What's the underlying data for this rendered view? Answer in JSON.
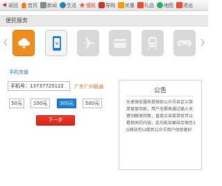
{
  "nav": {
    "items": [
      {
        "label": "返回",
        "icon": "back-arrow-icon"
      },
      {
        "label": "首页",
        "icon": "home-icon"
      },
      {
        "label": "新闻",
        "icon": "news-icon"
      },
      {
        "label": "生活",
        "icon": "life-icon"
      },
      {
        "label": "便民",
        "icon": "service-star-icon",
        "active": true
      },
      {
        "label": "导购",
        "icon": "guide-icon"
      },
      {
        "label": "优惠",
        "icon": "deal-icon"
      },
      {
        "label": "礼品",
        "icon": "gift-icon"
      },
      {
        "label": "地图",
        "icon": "map-icon"
      },
      {
        "label": "退出",
        "icon": "exit-icon"
      }
    ]
  },
  "section": {
    "title": "便民服务"
  },
  "services": [
    {
      "icon": "weather-cloud-icon",
      "state": "orange"
    },
    {
      "icon": "mobile-recharge-icon",
      "state": "selected"
    },
    {
      "icon": "airplane-icon",
      "state": "disabled"
    },
    {
      "icon": "card-icon",
      "state": "disabled"
    },
    {
      "icon": "train-icon",
      "state": "disabled"
    },
    {
      "icon": "gamepad-icon",
      "state": "disabled"
    }
  ],
  "form": {
    "title": "手机充值",
    "phone_value": "手机号：13737725122",
    "carrier": "广东广州联通",
    "amounts": [
      "50元",
      "100元",
      "300元",
      "500元"
    ],
    "selected_amount": "300元",
    "next_label": "下一步"
  },
  "notice": {
    "title": "公告",
    "body": "乐享微信服务提供给公众号自定义菜单营营功能，用户无需再通过输入关键词触发回复，直接点击菜单就可以看相关的内容，此功能如果结合微信3G网站可以做到公众号用户体验更好"
  },
  "colors": {
    "accent_orange": "#ee8d1c",
    "selected_blue": "#1f7fd6",
    "button_red": "#e0301f",
    "link_blue": "#2a6cb8",
    "carrier_orange": "#e0671b"
  }
}
